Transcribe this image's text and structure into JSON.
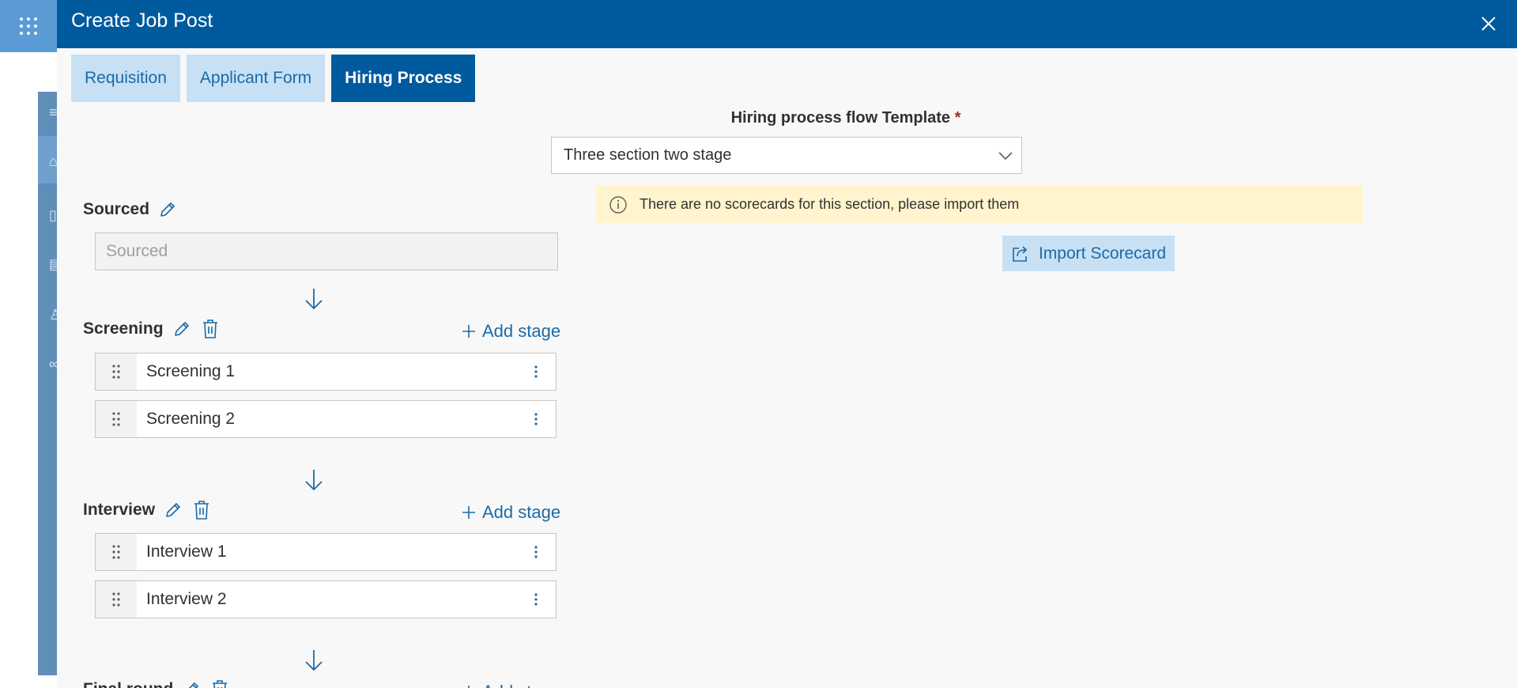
{
  "background": {
    "app_launcher_icon": "waffle-grid-icon",
    "sidebar_icons": [
      "menu-icon",
      "home-icon",
      "document-icon",
      "clipboard-icon",
      "person-icon",
      "people-icon"
    ]
  },
  "panel": {
    "title": "Create Job Post",
    "close_icon": "close-icon"
  },
  "tabs": [
    {
      "label": "Requisition",
      "active": false
    },
    {
      "label": "Applicant Form",
      "active": false
    },
    {
      "label": "Hiring Process",
      "active": true
    }
  ],
  "template": {
    "label": "Hiring process flow Template",
    "required_marker": "*",
    "selected": "Three section two stage"
  },
  "sections": [
    {
      "title": "Sourced",
      "field_value": "Sourced"
    },
    {
      "title": "Screening",
      "add_label": "Add stage",
      "stages": [
        "Screening 1",
        "Screening 2"
      ]
    },
    {
      "title": "Interview",
      "add_label": "Add stage",
      "stages": [
        "Interview 1",
        "Interview 2"
      ]
    },
    {
      "title": "Final round",
      "add_label": "Add stage"
    }
  ],
  "notice": {
    "icon": "info-icon",
    "text": "There are no scorecards for this section, please import them"
  },
  "import_button": {
    "label": "Import Scorecard",
    "icon": "share-icon"
  },
  "colors": {
    "header": "#005a9e",
    "accent": "#1b6aa8",
    "tab_inactive": "#c7e0f4",
    "notice_bg": "#fff4ce",
    "required": "#a4262c"
  }
}
